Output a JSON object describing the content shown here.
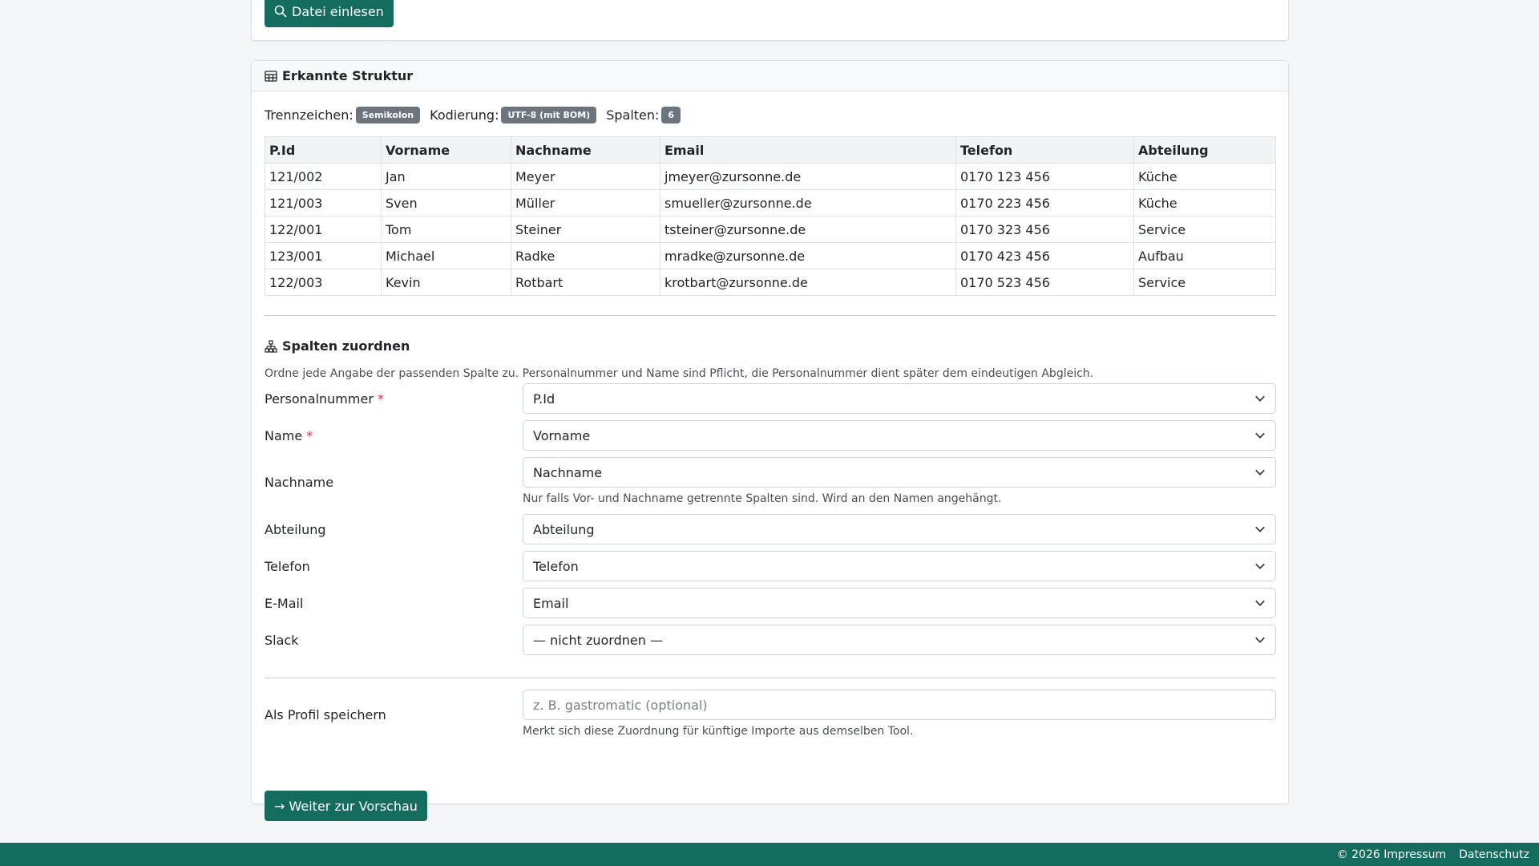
{
  "top_card": {
    "read_button": "Datei einlesen"
  },
  "structure": {
    "title": "Erkannte Struktur",
    "separator_label": "Trennzeichen:",
    "separator_value": "Semikolon",
    "encoding_label": "Kodierung:",
    "encoding_value": "UTF-8 (mit BOM)",
    "columns_label": "Spalten:",
    "columns_value": "6",
    "table": {
      "headers": [
        "P.Id",
        "Vorname",
        "Nachname",
        "Email",
        "Telefon",
        "Abteilung"
      ],
      "rows": [
        [
          "121/002",
          "Jan",
          "Meyer",
          "jmeyer@zursonne.de",
          "0170 123 456",
          "Küche"
        ],
        [
          "121/003",
          "Sven",
          "Müller",
          "smueller@zursonne.de",
          "0170 223 456",
          "Küche"
        ],
        [
          "122/001",
          "Tom",
          "Steiner",
          "tsteiner@zursonne.de",
          "0170 323 456",
          "Service"
        ],
        [
          "123/001",
          "Michael",
          "Radke",
          "mradke@zursonne.de",
          "0170 423 456",
          "Aufbau"
        ],
        [
          "122/003",
          "Kevin",
          "Rotbart",
          "krotbart@zursonne.de",
          "0170 523 456",
          "Service"
        ]
      ]
    }
  },
  "mapping": {
    "title": "Spalten zuordnen",
    "description": "Ordne jede Angabe der passenden Spalte zu. Personalnummer und Name sind Pflicht, die Personalnummer dient später dem eindeutigen Abgleich.",
    "required_mark": "*",
    "fields": {
      "personalnummer": {
        "label": "Personalnummer",
        "value": "P.Id"
      },
      "name": {
        "label": "Name",
        "value": "Vorname"
      },
      "nachname": {
        "label": "Nachname",
        "value": "Nachname",
        "help": "Nur falls Vor- und Nachname getrennte Spalten sind. Wird an den Namen angehängt."
      },
      "abteilung": {
        "label": "Abteilung",
        "value": "Abteilung"
      },
      "telefon": {
        "label": "Telefon",
        "value": "Telefon"
      },
      "email": {
        "label": "E-Mail",
        "value": "Email"
      },
      "slack": {
        "label": "Slack",
        "value": "— nicht zuordnen —"
      }
    },
    "profile": {
      "label": "Als Profil speichern",
      "placeholder": "z. B. gastromatic (optional)",
      "help": "Merkt sich diese Zuordnung für künftige Importe aus demselben Tool."
    },
    "next_button": "→ Weiter zur Vorschau"
  },
  "footer": {
    "impressum": "© 2026 Impressum",
    "datenschutz": "Datenschutz"
  },
  "colors": {
    "primary": "#146c5e",
    "badge": "#6c757d",
    "required": "#dc3545"
  }
}
